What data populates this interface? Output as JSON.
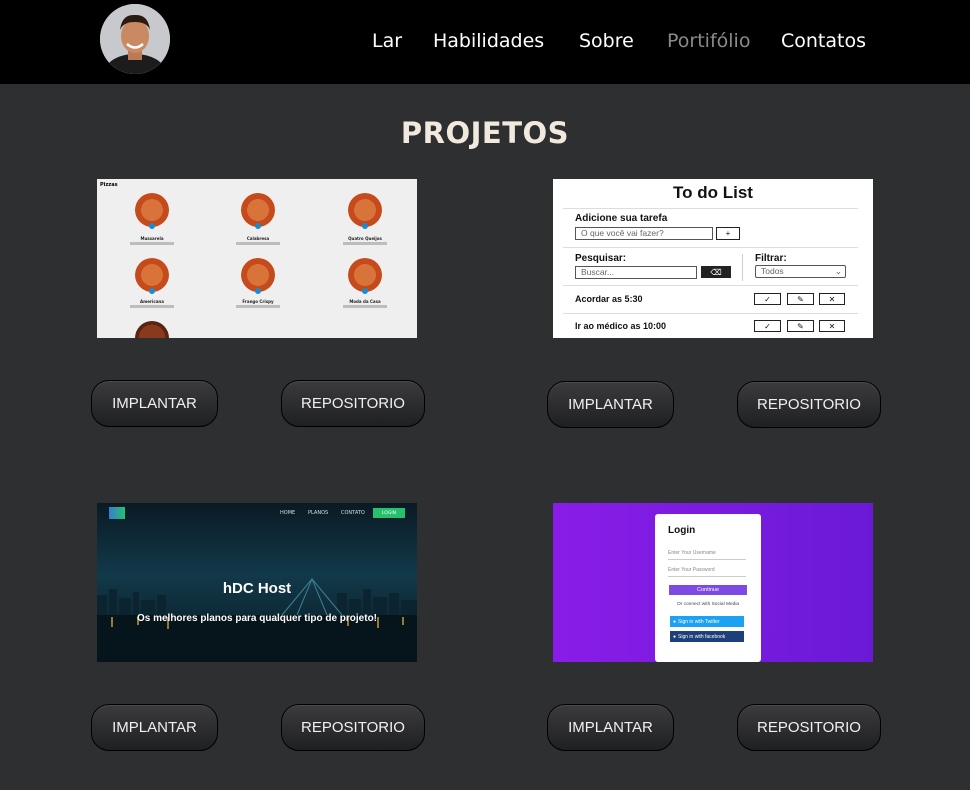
{
  "nav": {
    "items": [
      {
        "label": "Lar",
        "active": false
      },
      {
        "label": "Habilidades",
        "active": false
      },
      {
        "label": "Sobre",
        "active": false
      },
      {
        "label": "Portifólio",
        "active": true
      },
      {
        "label": "Contatos",
        "active": false
      }
    ]
  },
  "page_title": "PROJETOS",
  "projects": [
    {
      "thumb": "pizza-menu",
      "deploy_label": "IMPLANTAR",
      "repo_label": "REPOSITORIO",
      "preview": {
        "heading": "Pizzas",
        "items": [
          "Mussarela",
          "Calabresa",
          "Quatro Queijos",
          "Americana",
          "Frango Crispy",
          "Moda da Casa"
        ]
      }
    },
    {
      "thumb": "todo-list",
      "deploy_label": "IMPLANTAR",
      "repo_label": "REPOSITORIO",
      "preview": {
        "title": "To do List",
        "add_label": "Adicione sua tarefa",
        "add_placeholder": "O que você vai fazer?",
        "add_button": "+",
        "search_label": "Pesquisar:",
        "search_placeholder": "Buscar...",
        "filter_label": "Filtrar:",
        "filter_value": "Todos",
        "tasks": [
          "Acordar as 5:30",
          "Ir ao médico as 10:00"
        ]
      }
    },
    {
      "thumb": "hosting",
      "deploy_label": "IMPLANTAR",
      "repo_label": "REPOSITORIO",
      "preview": {
        "nav": [
          "HOME",
          "PLANOS",
          "CONTATO"
        ],
        "login": "LOGIN",
        "headline": "hDC Host",
        "tagline": "Os melhores planos para qualquer tipo de projeto!"
      }
    },
    {
      "thumb": "login-form",
      "deploy_label": "IMPLANTAR",
      "repo_label": "REPOSITORIO",
      "preview": {
        "title": "Login",
        "username_placeholder": "Enter Your Username",
        "password_placeholder": "Enter Your Password",
        "continue": "Continue",
        "social_text": "Or connect with Social Media",
        "twitter": "Sign in with Twitter",
        "facebook": "Sign in with facebook"
      }
    }
  ],
  "colors": {
    "background": "#2e2f31",
    "header": "#000000",
    "title": "#f2e9de",
    "nav_active": "#8a8a8a"
  }
}
